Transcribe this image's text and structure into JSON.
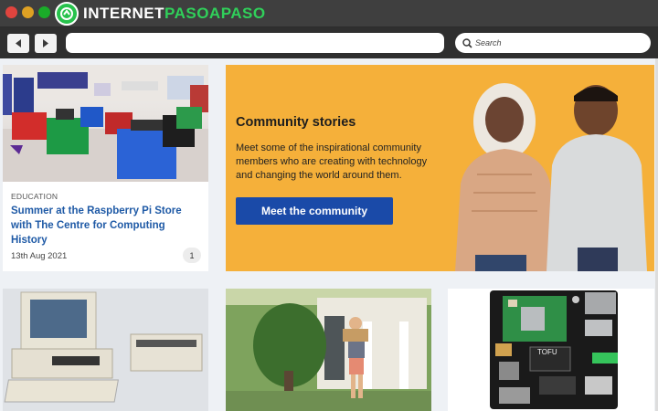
{
  "window": {
    "brand_prefix": "INTERNET",
    "brand_green": "PASOAPASO"
  },
  "toolbar": {
    "back_icon": "back-arrow-icon",
    "forward_icon": "forward-arrow-icon",
    "url_value": "",
    "search_placeholder": "Search"
  },
  "article": {
    "category": "EDUCATION",
    "title": "Summer at the Raspberry Pi Store with The Centre for Computing History",
    "date": "13th Aug 2021",
    "comments": "1"
  },
  "hero": {
    "heading": "Community stories",
    "body": "Meet some of the inspirational community members who are creating with technology and changing the world around them.",
    "cta": "Meet the community"
  },
  "board": {
    "chip_label": "TOFU"
  },
  "colors": {
    "hero_bg": "#f5b03a",
    "cta_bg": "#1a4aa8",
    "link": "#1f5aa6",
    "brand_green": "#30d05a"
  }
}
